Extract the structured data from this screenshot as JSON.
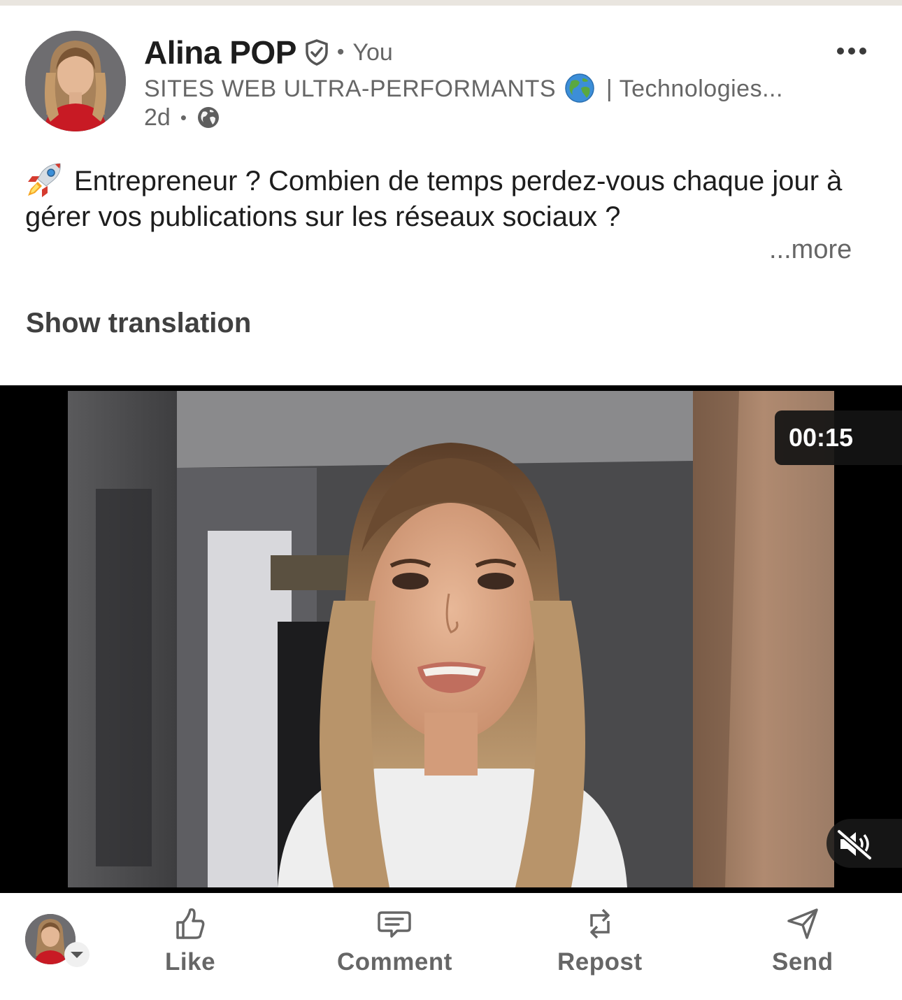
{
  "post": {
    "author": {
      "name": "Alina POP",
      "relation": "You",
      "headline_start": "SITES WEB ULTRA-PERFORMANTS",
      "headline_end": " | Technologies...",
      "verified_icon": "verified-shield-icon"
    },
    "meta": {
      "time": "2d",
      "separator": "•",
      "visibility_icon": "globe-icon"
    },
    "text": {
      "body": "Entrepreneur ? Combien de temps perdez-vous chaque jour à gérer vos publications sur les réseaux sociaux ?",
      "see_more": "...more",
      "show_translation": "Show translation"
    },
    "video": {
      "duration": "00:15",
      "muted": true
    },
    "actions": [
      {
        "label": "Like",
        "icon": "thumbs-up-icon"
      },
      {
        "label": "Comment",
        "icon": "comment-icon"
      },
      {
        "label": "Repost",
        "icon": "repost-icon"
      },
      {
        "label": "Send",
        "icon": "send-icon"
      }
    ]
  },
  "colors": {
    "text_primary": "#1d1d1d",
    "text_secondary": "#666666",
    "video_bg": "#000000"
  }
}
